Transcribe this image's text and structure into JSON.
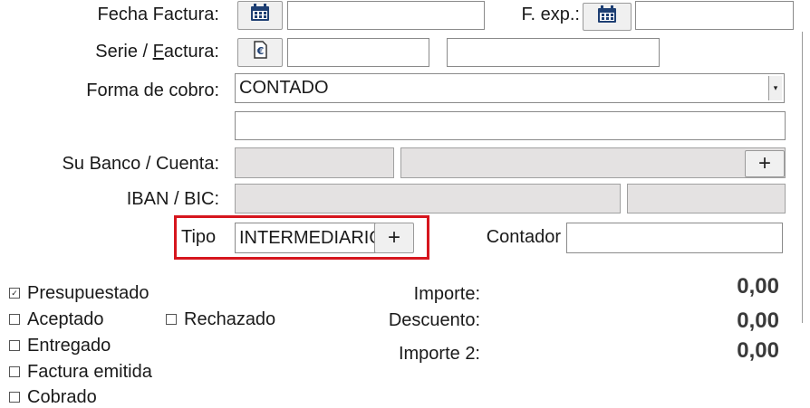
{
  "form": {
    "fecha_factura": {
      "label": "Fecha Factura:",
      "value": ""
    },
    "f_exp": {
      "label": "F. exp.:",
      "value": ""
    },
    "serie_factura": {
      "label_pre": "Serie / ",
      "label_underline": "F",
      "label_post": "actura:",
      "serie_value": "",
      "factura_value": ""
    },
    "forma_cobro": {
      "label": "Forma de cobro:",
      "selected": "CONTADO",
      "extra_value": ""
    },
    "su_banco": {
      "label": "Su Banco / Cuenta:",
      "banco_value": "",
      "cuenta_value": ""
    },
    "iban_bic": {
      "label": "IBAN / BIC:",
      "iban_value": "",
      "bic_value": ""
    },
    "tipo": {
      "label": "Tipo",
      "value": "INTERMEDIARIO"
    },
    "contador": {
      "label": "Contador",
      "value": ""
    }
  },
  "status": {
    "presupuestado": {
      "label": "Presupuestado",
      "checked": true
    },
    "aceptado": {
      "label": "Aceptado",
      "checked": false
    },
    "rechazado": {
      "label": "Rechazado",
      "checked": false
    },
    "entregado": {
      "label": "Entregado",
      "checked": false
    },
    "factura_emitida": {
      "label": "Factura emitida",
      "checked": false
    },
    "cobrado": {
      "label": "Cobrado",
      "checked": false
    }
  },
  "totals": {
    "importe": {
      "label": "Importe:",
      "value": "0,00"
    },
    "descuento": {
      "label": "Descuento:",
      "value": "0,00"
    },
    "importe2": {
      "label": "Importe 2:",
      "value": "0,00"
    }
  },
  "icons": {
    "calendar": "calendar-icon",
    "euro": "euro-icon",
    "plus": "+",
    "check": "✓",
    "dropdown": "▾"
  },
  "colors": {
    "highlight": "#d6161e",
    "gray_field": "#e4e2e2"
  }
}
